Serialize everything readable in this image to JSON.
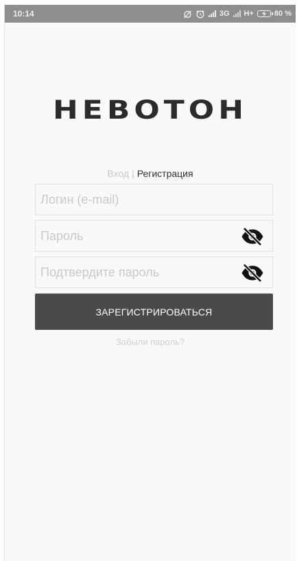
{
  "status_bar": {
    "time": "10:14",
    "network_1": "3G",
    "network_2": "H+",
    "battery": "80 %"
  },
  "logo": {
    "text": "НЕВОТОН"
  },
  "tabs": {
    "login": "Вход",
    "separator": "|",
    "register": "Регистрация"
  },
  "form": {
    "login_placeholder": "Логин (e-mail)",
    "password_placeholder": "Пароль",
    "confirm_placeholder": "Подтвердите пароль",
    "submit_label": "ЗАРЕГИСТРИРОВАТЬСЯ",
    "forgot_label": "Забыли пароль?"
  },
  "icons": {
    "password_toggle": "eye-off-icon",
    "confirm_toggle": "eye-off-icon"
  },
  "colors": {
    "button_bg": "#4a4a4a",
    "status_bar_bg": "#8e8e8e",
    "placeholder": "#c9c9c9"
  }
}
